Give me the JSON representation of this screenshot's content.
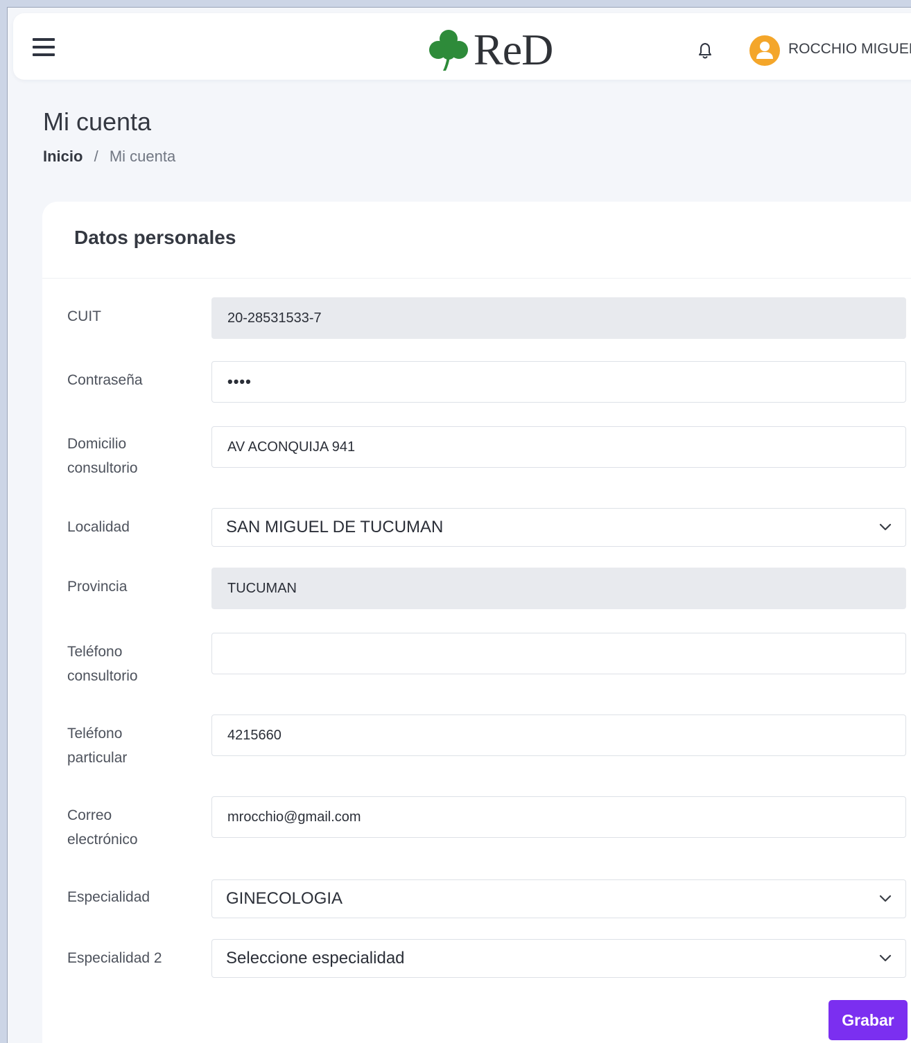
{
  "header": {
    "logo_text": "ReD",
    "user_name": "ROCCHIO MIGUEL"
  },
  "page": {
    "title": "Mi cuenta",
    "breadcrumb": {
      "home": "Inicio",
      "separator": "/",
      "current": "Mi cuenta"
    }
  },
  "form": {
    "title": "Datos personales",
    "fields": {
      "cuit": {
        "label": "CUIT",
        "value": "20-28531533-7"
      },
      "password": {
        "label": "Contraseña",
        "value": "••••"
      },
      "address": {
        "label_line1": "Domicilio",
        "label_line2": "consultorio",
        "value": "AV ACONQUIJA 941"
      },
      "city": {
        "label": "Localidad",
        "value": "SAN MIGUEL DE TUCUMAN"
      },
      "province": {
        "label": "Provincia",
        "value": "TUCUMAN"
      },
      "office_phone": {
        "label_line1": "Teléfono",
        "label_line2": "consultorio",
        "value": ""
      },
      "personal_phone": {
        "label_line1": "Teléfono",
        "label_line2": "particular",
        "value": "4215660"
      },
      "email": {
        "label_line1": "Correo",
        "label_line2": "electrónico",
        "value": "mrocchio@gmail.com"
      },
      "specialty": {
        "label": "Especialidad",
        "value": "GINECOLOGIA"
      },
      "specialty2": {
        "label": "Especialidad 2",
        "value": "Seleccione especialidad"
      }
    },
    "save_label": "Grabar"
  },
  "colors": {
    "accent": "#7b2ff0",
    "avatar": "#f4a62a",
    "logo_leaf": "#2e8b3a",
    "readonly_bg": "#e8eaee"
  },
  "icons": {
    "menu": "hamburger-menu-icon",
    "notifications": "bell-icon",
    "user": "user-avatar-icon",
    "logo": "clover-icon",
    "dropdown": "chevron-down-icon"
  }
}
